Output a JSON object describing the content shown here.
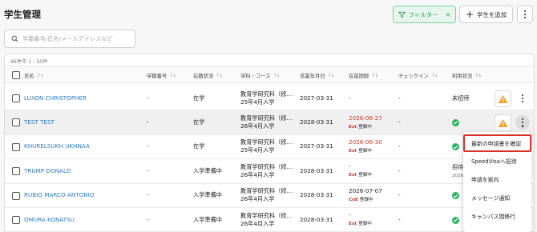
{
  "page": {
    "title": "学生管理"
  },
  "toolbar": {
    "filter_label": "フィルター",
    "filter_clear": "×",
    "add_label": "学生を追加"
  },
  "search": {
    "placeholder": "学籍番号/氏名/メールアドレスなど"
  },
  "table": {
    "count_text": "96件中 1 - 50件",
    "columns": [
      "氏名",
      "学籍番号",
      "在籍状況",
      "学科・コース",
      "卒業年月日",
      "在留期限",
      "チェックイン",
      "利用状況"
    ],
    "rows": [
      {
        "name": "LUXON CHRISTOPHER",
        "student_id": "-",
        "status": "在学",
        "course_line1": "教育学研究科（修...",
        "course_line2": "25年4月入学",
        "graduation": "2027-03-31",
        "visa_date": "-",
        "visa_ext": "",
        "visa_note": "",
        "checkin": "-",
        "usage": "未招待",
        "usage_type": "text",
        "warn": true,
        "menu_active": false
      },
      {
        "name": "TEST TEST",
        "student_id": "-",
        "status": "在学",
        "course_line1": "教育学研究科（修...",
        "course_line2": "26年4月入学",
        "graduation": "2028-03-31",
        "visa_date": "2026-06-27",
        "visa_ext": "Ext",
        "visa_note": "登録中",
        "checkin": "-",
        "usage": "",
        "usage_type": "check",
        "warn": true,
        "menu_active": true
      },
      {
        "name": "KHURELSUKH UKHNAA",
        "student_id": "-",
        "status": "在学",
        "course_line1": "教育学研究科（修...",
        "course_line2": "25年4月入学",
        "graduation": "2027-03-31",
        "visa_date": "2026-06-30",
        "visa_ext": "Ext",
        "visa_note": "登録中",
        "checkin": "-",
        "usage": "",
        "usage_type": "check",
        "warn": false,
        "menu_active": false
      },
      {
        "name": "TRUMP DONALD",
        "student_id": "-",
        "status": "入学準備中",
        "course_line1": "教育学研究科（修...",
        "course_line2": "26年4月入学",
        "graduation": "2028-03-31",
        "visa_date": "-",
        "visa_ext": "Ext",
        "visa_note": "登録中",
        "checkin": "-",
        "usage": "招待済",
        "usage_sub": "2026-...",
        "usage_type": "partial",
        "warn": false,
        "menu_active": false
      },
      {
        "name": "RUBIO MARCO ANTONIO",
        "student_id": "-",
        "status": "入学準備中",
        "course_line1": "教育学研究科（修...",
        "course_line2": "26年4月入学",
        "graduation": "2028-03-31",
        "visa_date": "2026-07-07",
        "visa_ext": "CoE",
        "visa_note": "登録中",
        "checkin": "-",
        "usage": "",
        "usage_type": "check",
        "warn": false,
        "menu_active": false
      },
      {
        "name": "OMURA KONATSU",
        "student_id": "-",
        "status": "入学準備中",
        "course_line1": "教育学研究科（修...",
        "course_line2": "26年4月入学",
        "graduation": "2028-03-31",
        "visa_date": "-",
        "visa_ext": "Ext",
        "visa_note": "登録中",
        "checkin": "-",
        "usage": "",
        "usage_type": "check",
        "warn": false,
        "menu_active": false
      }
    ]
  },
  "context_menu": {
    "items": [
      "最新の申請書を確認",
      "SpeedVisaへ招待",
      "申請を案内",
      "メッセージ通知",
      "キャンパス間移行"
    ]
  },
  "colors": {
    "link": "#2e7bbf",
    "danger": "#d43a2a",
    "success": "#2bb460",
    "warning": "#f0a12a",
    "filter_accent": "#2f9e5f"
  }
}
